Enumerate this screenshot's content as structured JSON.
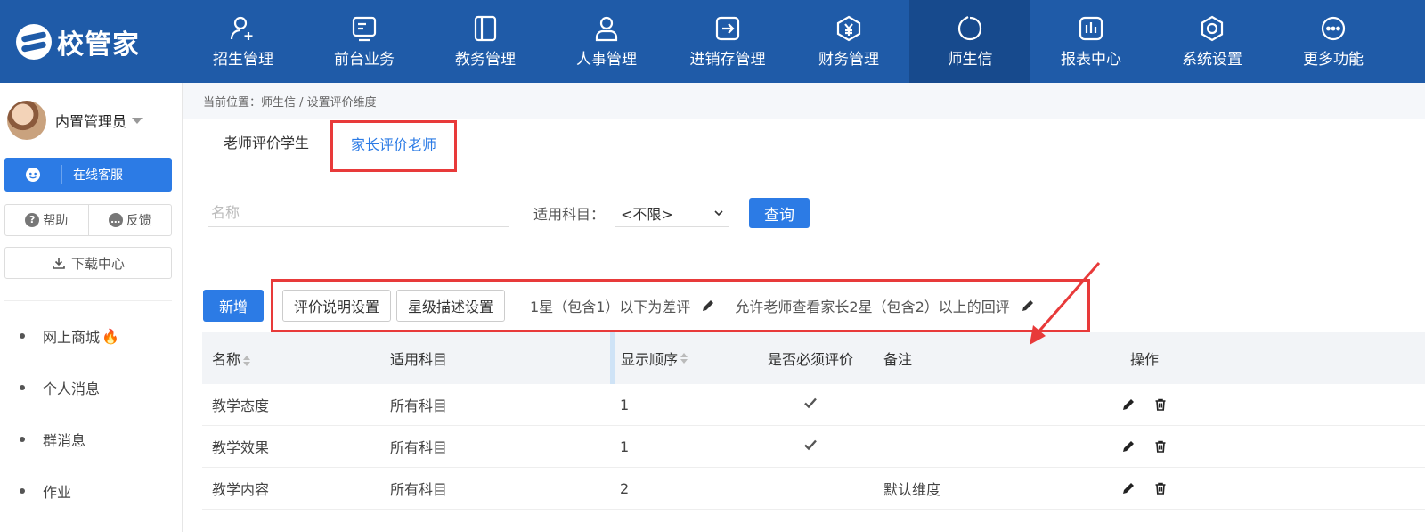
{
  "app": {
    "logo_text": "校管家"
  },
  "nav": [
    {
      "label": "招生管理",
      "icon": "add-user-icon"
    },
    {
      "label": "前台业务",
      "icon": "monitor-icon"
    },
    {
      "label": "教务管理",
      "icon": "book-icon"
    },
    {
      "label": "人事管理",
      "icon": "person-icon"
    },
    {
      "label": "进销存管理",
      "icon": "inventory-icon"
    },
    {
      "label": "财务管理",
      "icon": "finance-icon"
    },
    {
      "label": "师生信",
      "icon": "chat-icon",
      "active": true
    },
    {
      "label": "报表中心",
      "icon": "report-icon"
    },
    {
      "label": "系统设置",
      "icon": "settings-icon"
    },
    {
      "label": "更多功能",
      "icon": "more-icon"
    }
  ],
  "sidebar": {
    "user_name": "内置管理员",
    "service_label": "在线客服",
    "help_label": "帮助",
    "feedback_label": "反馈",
    "download_label": "下载中心",
    "menu": [
      {
        "label": "网上商城"
      },
      {
        "label": "个人消息"
      },
      {
        "label": "群消息"
      },
      {
        "label": "作业"
      }
    ]
  },
  "breadcrumb": "当前位置：师生信 / 设置评价维度",
  "tabs": [
    {
      "label": "老师评价学生"
    },
    {
      "label": "家长评价老师",
      "active": true
    }
  ],
  "filter": {
    "name_placeholder": "名称",
    "subject_label": "适用科目：",
    "subject_value": "<不限>",
    "query_label": "查询"
  },
  "actions": {
    "add_label": "新增",
    "desc_setting_label": "评价说明设置",
    "star_setting_label": "星级描述设置",
    "bad_rule": "1星（包含1）以下为差评",
    "view_rule": "允许老师查看家长2星（包含2）以上的回评"
  },
  "table": {
    "columns": [
      "名称",
      "适用科目",
      "显示顺序",
      "是否必须评价",
      "备注",
      "操作"
    ],
    "rows": [
      {
        "name": "教学态度",
        "subject": "所有科目",
        "order": "1",
        "required": true,
        "note": ""
      },
      {
        "name": "教学效果",
        "subject": "所有科目",
        "order": "1",
        "required": true,
        "note": ""
      },
      {
        "name": "教学内容",
        "subject": "所有科目",
        "order": "2",
        "required": false,
        "note": "默认维度"
      }
    ]
  },
  "colors": {
    "brand": "#1f5ba8",
    "primary": "#2c7be5",
    "highlight": "#e83a3a"
  }
}
